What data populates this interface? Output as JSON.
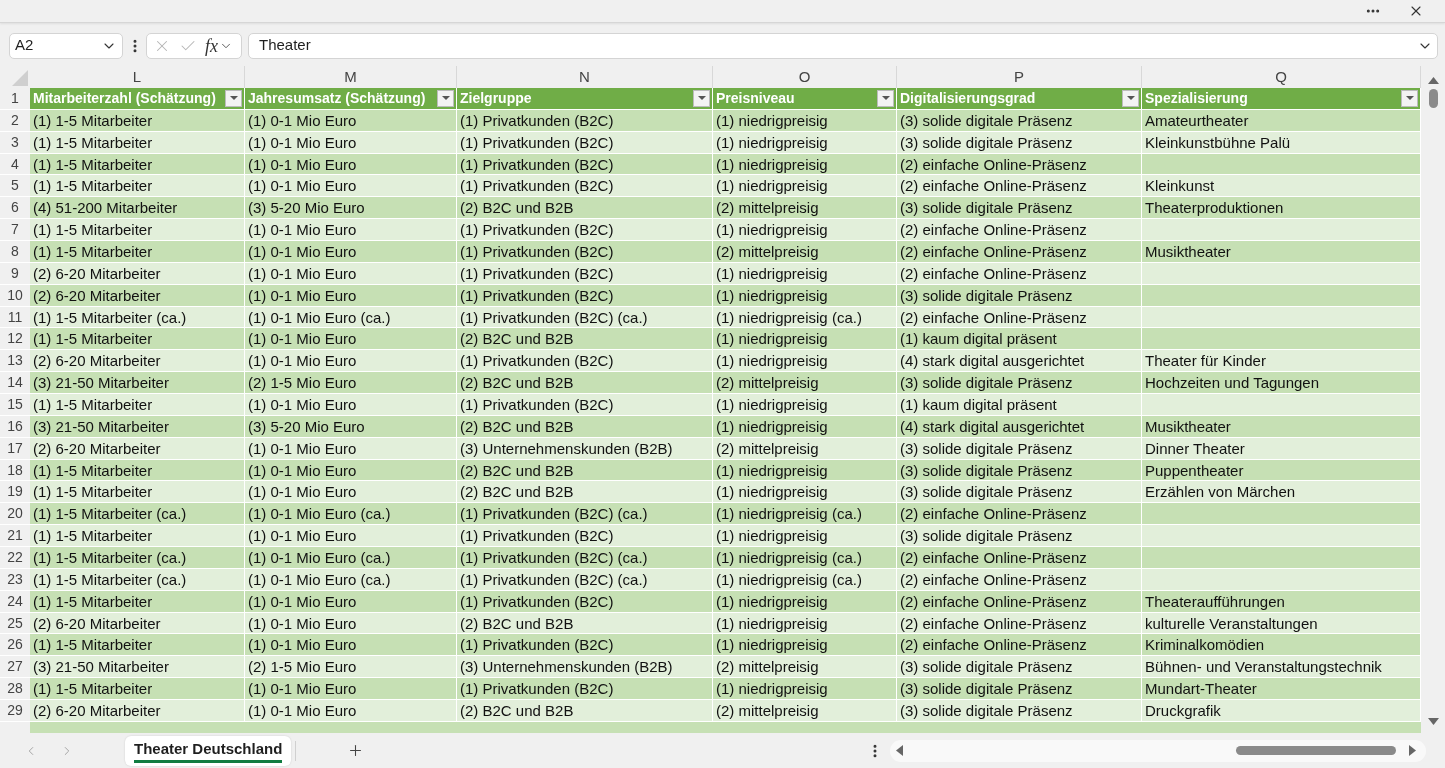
{
  "formula_bar": {
    "name_box": "A2",
    "function_label": "fx",
    "formula": "Theater"
  },
  "sheet": {
    "column_letters": [
      "L",
      "M",
      "N",
      "O",
      "P",
      "Q"
    ],
    "header_row": {
      "number": "1",
      "columns": [
        "Mitarbeiterzahl (Schätzung)",
        "Jahresumsatz (Schätzung)",
        "Zielgruppe",
        "Preisniveau",
        "Digitalisierungsgrad",
        "Spezialisierung"
      ]
    },
    "rows": [
      {
        "number": "2",
        "cells": [
          "(1) 1-5 Mitarbeiter",
          "(1) 0-1 Mio Euro",
          "(1) Privatkunden (B2C)",
          "(1) niedrigpreisig",
          "(3) solide digitale Präsenz",
          "Amateurtheater"
        ]
      },
      {
        "number": "3",
        "cells": [
          "(1) 1-5 Mitarbeiter",
          "(1) 0-1 Mio Euro",
          "(1) Privatkunden (B2C)",
          "(1) niedrigpreisig",
          "(3) solide digitale Präsenz",
          "Kleinkunstbühne Palü"
        ]
      },
      {
        "number": "4",
        "cells": [
          "(1) 1-5 Mitarbeiter",
          "(1) 0-1 Mio Euro",
          "(1) Privatkunden (B2C)",
          "(1) niedrigpreisig",
          "(2) einfache Online-Präsenz"
        ]
      },
      {
        "number": "5",
        "cells": [
          "(1) 1-5 Mitarbeiter",
          "(1) 0-1 Mio Euro",
          "(1) Privatkunden (B2C)",
          "(1) niedrigpreisig",
          "(2) einfache Online-Präsenz",
          "Kleinkunst"
        ]
      },
      {
        "number": "6",
        "cells": [
          "(4) 51-200 Mitarbeiter",
          "(3) 5-20 Mio Euro",
          "(2) B2C und B2B",
          "(2) mittelpreisig",
          "(3) solide digitale Präsenz",
          "Theaterproduktionen"
        ]
      },
      {
        "number": "7",
        "cells": [
          "(1) 1-5 Mitarbeiter",
          "(1) 0-1 Mio Euro",
          "(1) Privatkunden (B2C)",
          "(1) niedrigpreisig",
          "(2) einfache Online-Präsenz"
        ]
      },
      {
        "number": "8",
        "cells": [
          "(1) 1-5 Mitarbeiter",
          "(1) 0-1 Mio Euro",
          "(1) Privatkunden (B2C)",
          "(2) mittelpreisig",
          "(2) einfache Online-Präsenz",
          "Musiktheater"
        ]
      },
      {
        "number": "9",
        "cells": [
          "(2) 6-20 Mitarbeiter",
          "(1) 0-1 Mio Euro",
          "(1) Privatkunden (B2C)",
          "(1) niedrigpreisig",
          "(2) einfache Online-Präsenz"
        ]
      },
      {
        "number": "10",
        "cells": [
          "(2) 6-20 Mitarbeiter",
          "(1) 0-1 Mio Euro",
          "(1) Privatkunden (B2C)",
          "(1) niedrigpreisig",
          "(3) solide digitale Präsenz"
        ]
      },
      {
        "number": "11",
        "cells": [
          "(1) 1-5 Mitarbeiter (ca.)",
          "(1) 0-1 Mio Euro (ca.)",
          "(1) Privatkunden (B2C) (ca.)",
          "(1) niedrigpreisig (ca.)",
          "(2) einfache Online-Präsenz"
        ]
      },
      {
        "number": "12",
        "cells": [
          "(1) 1-5 Mitarbeiter",
          "(1) 0-1 Mio Euro",
          "(2) B2C und B2B",
          "(1) niedrigpreisig",
          "(1) kaum digital präsent"
        ]
      },
      {
        "number": "13",
        "cells": [
          "(2) 6-20 Mitarbeiter",
          "(1) 0-1 Mio Euro",
          "(1) Privatkunden (B2C)",
          "(1) niedrigpreisig",
          "(4) stark digital ausgerichtet",
          "Theater für Kinder"
        ]
      },
      {
        "number": "14",
        "cells": [
          "(3) 21-50 Mitarbeiter",
          "(2) 1-5 Mio Euro",
          "(2) B2C und B2B",
          "(2) mittelpreisig",
          "(3) solide digitale Präsenz",
          "Hochzeiten und Tagungen"
        ]
      },
      {
        "number": "15",
        "cells": [
          "(1) 1-5 Mitarbeiter",
          "(1) 0-1 Mio Euro",
          "(1) Privatkunden (B2C)",
          "(1) niedrigpreisig",
          "(1) kaum digital präsent"
        ]
      },
      {
        "number": "16",
        "cells": [
          "(3) 21-50 Mitarbeiter",
          "(3) 5-20 Mio Euro",
          "(2) B2C und B2B",
          "(1) niedrigpreisig",
          "(4) stark digital ausgerichtet",
          "Musiktheater"
        ]
      },
      {
        "number": "17",
        "cells": [
          "(2) 6-20 Mitarbeiter",
          "(1) 0-1 Mio Euro",
          "(3) Unternehmenskunden (B2B)",
          "(2) mittelpreisig",
          "(3) solide digitale Präsenz",
          "Dinner Theater"
        ]
      },
      {
        "number": "18",
        "cells": [
          "(1) 1-5 Mitarbeiter",
          "(1) 0-1 Mio Euro",
          "(2) B2C und B2B",
          "(1) niedrigpreisig",
          "(3) solide digitale Präsenz",
          "Puppentheater"
        ]
      },
      {
        "number": "19",
        "cells": [
          "(1) 1-5 Mitarbeiter",
          "(1) 0-1 Mio Euro",
          "(2) B2C und B2B",
          "(1) niedrigpreisig",
          "(3) solide digitale Präsenz",
          "Erzählen von Märchen"
        ]
      },
      {
        "number": "20",
        "cells": [
          "(1) 1-5 Mitarbeiter (ca.)",
          "(1) 0-1 Mio Euro (ca.)",
          "(1) Privatkunden (B2C) (ca.)",
          "(1) niedrigpreisig (ca.)",
          "(2) einfache Online-Präsenz"
        ]
      },
      {
        "number": "21",
        "cells": [
          "(1) 1-5 Mitarbeiter",
          "(1) 0-1 Mio Euro",
          "(1) Privatkunden (B2C)",
          "(1) niedrigpreisig",
          "(3) solide digitale Präsenz"
        ]
      },
      {
        "number": "22",
        "cells": [
          "(1) 1-5 Mitarbeiter (ca.)",
          "(1) 0-1 Mio Euro (ca.)",
          "(1) Privatkunden (B2C) (ca.)",
          "(1) niedrigpreisig (ca.)",
          "(2) einfache Online-Präsenz"
        ]
      },
      {
        "number": "23",
        "cells": [
          "(1) 1-5 Mitarbeiter (ca.)",
          "(1) 0-1 Mio Euro (ca.)",
          "(1) Privatkunden (B2C) (ca.)",
          "(1) niedrigpreisig (ca.)",
          "(2) einfache Online-Präsenz"
        ]
      },
      {
        "number": "24",
        "cells": [
          "(1) 1-5 Mitarbeiter",
          "(1) 0-1 Mio Euro",
          "(1) Privatkunden (B2C)",
          "(1) niedrigpreisig",
          "(2) einfache Online-Präsenz",
          "Theateraufführungen"
        ]
      },
      {
        "number": "25",
        "cells": [
          "(2) 6-20 Mitarbeiter",
          "(1) 0-1 Mio Euro",
          "(2) B2C und B2B",
          "(1) niedrigpreisig",
          "(2) einfache Online-Präsenz",
          "kulturelle Veranstaltungen"
        ]
      },
      {
        "number": "26",
        "cells": [
          "(1) 1-5 Mitarbeiter",
          "(1) 0-1 Mio Euro",
          "(1) Privatkunden (B2C)",
          "(1) niedrigpreisig",
          "(2) einfache Online-Präsenz",
          "Kriminalkomödien"
        ]
      },
      {
        "number": "27",
        "cells": [
          "(3) 21-50 Mitarbeiter",
          "(2) 1-5 Mio Euro",
          "(3) Unternehmenskunden (B2B)",
          "(2) mittelpreisig",
          "(3) solide digitale Präsenz",
          "Bühnen- und Veranstaltungstechnik"
        ]
      },
      {
        "number": "28",
        "cells": [
          "(1) 1-5 Mitarbeiter",
          "(1) 0-1 Mio Euro",
          "(1) Privatkunden (B2C)",
          "(1) niedrigpreisig",
          "(3) solide digitale Präsenz",
          "Mundart-Theater"
        ]
      },
      {
        "number": "29",
        "cells": [
          "(2) 6-20 Mitarbeiter",
          "(1) 0-1 Mio Euro",
          "(2) B2C und B2B",
          "(2) mittelpreisig",
          "(3) solide digitale Präsenz",
          "Druckgrafik"
        ]
      }
    ]
  },
  "sheet_tabs": [
    {
      "label": "Theater Deutschland",
      "selected": true
    }
  ]
}
